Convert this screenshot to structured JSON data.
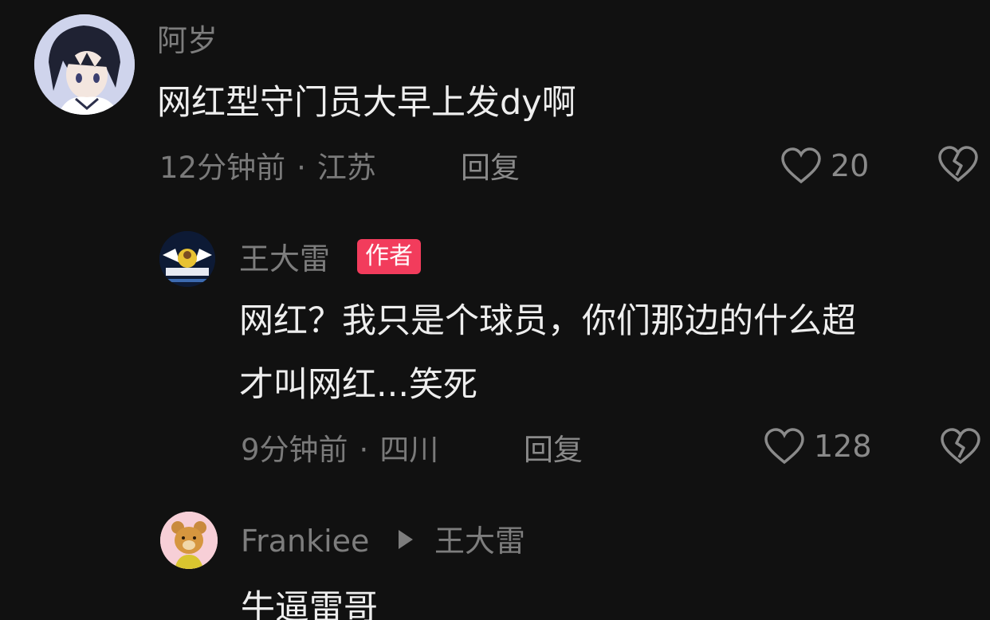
{
  "comments": [
    {
      "username": "阿岁",
      "text": "网红型守门员大早上发dy啊",
      "time": "12分钟前",
      "location": "江苏",
      "reply_label": "回复",
      "likes": "20"
    },
    {
      "username": "王大雷",
      "badge": "作者",
      "text_line1": "网红？我只是个球员，你们那边的什么超",
      "text_line2": "才叫网红...笑死",
      "time": "9分钟前",
      "location": "四川",
      "reply_label": "回复",
      "likes": "128"
    },
    {
      "username": "Frankiee",
      "reply_to": "王大雷",
      "text": "牛逼雷哥"
    }
  ],
  "separator": "·",
  "colors": {
    "background": "#111111",
    "author_badge": "#f23c5c",
    "primary_text": "#eeeeee",
    "secondary_text": "#7d7d7d"
  }
}
